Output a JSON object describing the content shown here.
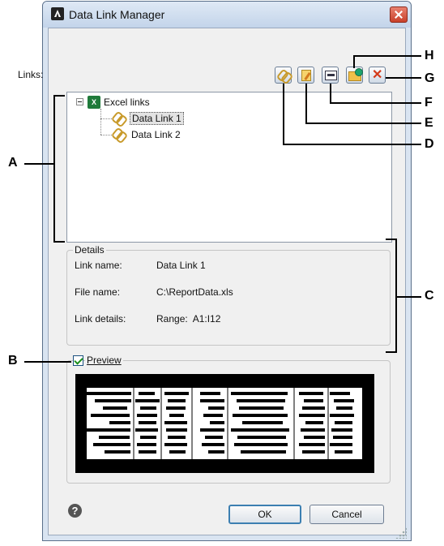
{
  "window": {
    "title": "Data Link Manager"
  },
  "links": {
    "label": "Links:",
    "toolbar": {
      "icons": [
        "new-excel-data-link-icon",
        "modify-data-link-icon",
        "open-excel-file-icon",
        "link-new-excel-file-icon",
        "delete-data-link-icon"
      ]
    },
    "tree": {
      "root": {
        "label": "Excel links",
        "icon_text": "X"
      },
      "items": [
        {
          "label": "Data Link 1",
          "selected": true
        },
        {
          "label": "Data Link 2",
          "selected": false
        }
      ]
    }
  },
  "details": {
    "title": "Details",
    "rows": [
      {
        "label": "Link name:",
        "value": "Data Link 1"
      },
      {
        "label": "File name:",
        "value": "C:\\ReportData.xls"
      },
      {
        "label": "Link details:",
        "value": "Range:  A1:I12"
      }
    ]
  },
  "preview": {
    "label": "Preview",
    "checked": true
  },
  "buttons": {
    "help_icon_text": "?",
    "ok": "OK",
    "cancel": "Cancel"
  },
  "callouts": {
    "A": "A",
    "B": "B",
    "C": "C",
    "D": "D",
    "E": "E",
    "F": "F",
    "G": "G",
    "H": "H"
  },
  "colors": {
    "title_bar": "#c3d4ea",
    "close_button": "#c9402a",
    "tree_selection": "#e3e3e3",
    "focus_border": "#3c7fb1"
  }
}
